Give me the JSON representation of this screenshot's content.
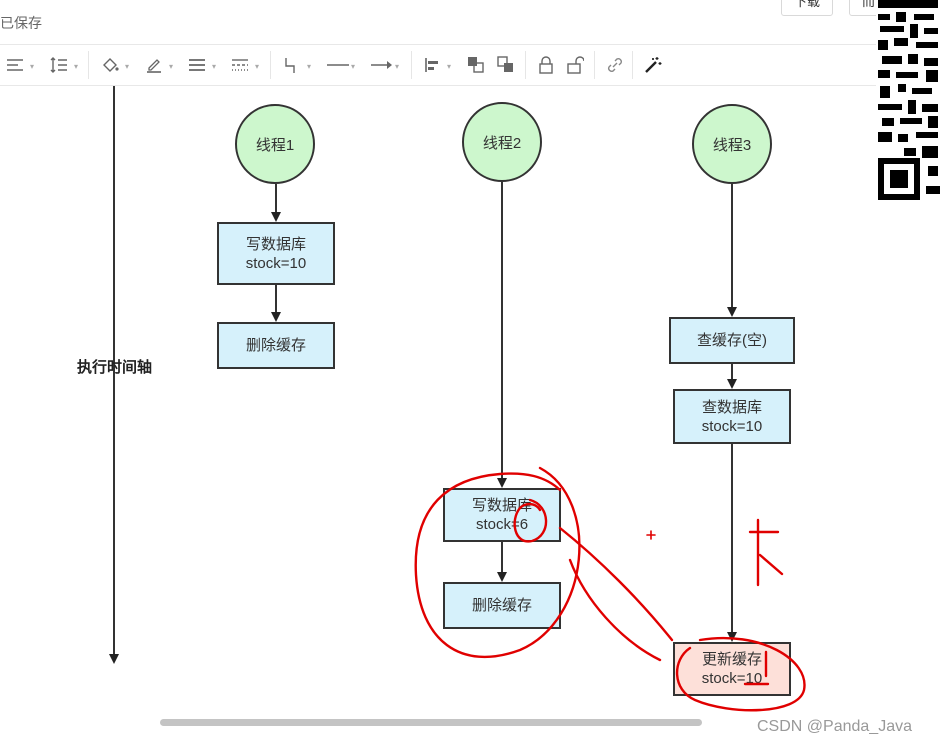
{
  "header": {
    "status": "已保存",
    "buttons": [
      "下载",
      "而"
    ]
  },
  "toolbar": {
    "icons": [
      "align-left-icon",
      "line-spacing-icon",
      "fill-color-icon",
      "line-color-icon",
      "line-weight-icon",
      "line-style-icon",
      "connector-icon",
      "line-icon",
      "arrow-icon",
      "align-icon",
      "front-icon",
      "back-icon",
      "lock-icon",
      "unlock-icon",
      "link-icon",
      "magic-wand-icon"
    ]
  },
  "diagram": {
    "axis_label": "执行时间轴",
    "threads": [
      {
        "label": "线程1"
      },
      {
        "label": "线程2"
      },
      {
        "label": "线程3"
      }
    ],
    "t1_nodes": [
      {
        "line1": "写数据库",
        "line2": "stock=10"
      },
      {
        "line1": "删除缓存",
        "line2": ""
      }
    ],
    "t2_nodes": [
      {
        "line1": "写数据库",
        "line2": "stock=6"
      },
      {
        "line1": "删除缓存",
        "line2": ""
      }
    ],
    "t3_nodes": [
      {
        "line1": "查缓存(空)",
        "line2": ""
      },
      {
        "line1": "查数据库",
        "line2": "stock=10"
      },
      {
        "line1": "更新缓存",
        "line2": "stock=10"
      }
    ],
    "annotation": "卡",
    "annotation_color": "#e00000"
  },
  "footer": {
    "watermark": "CSDN @Panda_Java"
  }
}
